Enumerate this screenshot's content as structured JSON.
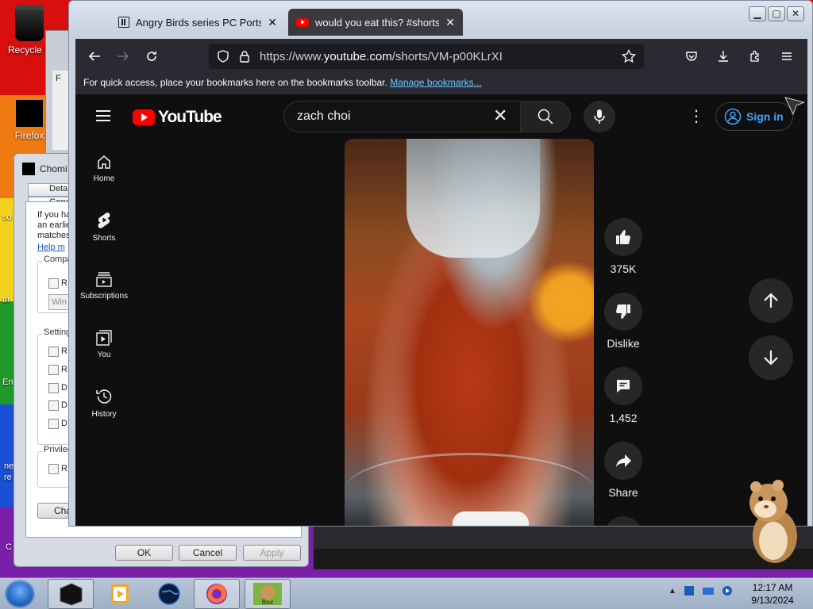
{
  "desktop": {
    "icons": [
      {
        "label": "Recycle B"
      },
      {
        "label": "Firefox"
      }
    ],
    "side_labels": [
      "so",
      "th",
      "En",
      "ne",
      "re",
      "C"
    ]
  },
  "bg_dialog": {
    "title": "Chomi",
    "tabs": [
      "Deta",
      "Genera"
    ],
    "intro_lines": [
      "If you ha",
      "an earlie",
      "matches"
    ],
    "help_link": "Help m",
    "group_compat": "Compa",
    "compat_checkbox": "R",
    "compat_dropdown": "Win",
    "group_settings": "Setting",
    "settings_items": [
      "R",
      "R",
      "D",
      "D",
      "D"
    ],
    "group_priv": "Privileg",
    "priv_item": "R",
    "change_button": "Cha",
    "ok": "OK",
    "cancel": "Cancel",
    "apply": "Apply"
  },
  "gray_window": {
    "label": "F"
  },
  "browser": {
    "tabs": [
      {
        "title": "Angry Birds series PC Ports : Ro"
      },
      {
        "title": "would you eat this? #shorts - Yo"
      }
    ],
    "url_prefix": "https://www.",
    "url_host": "youtube.com",
    "url_path": "/shorts/VM-p00KLrXI",
    "bookmarks_text": "For quick access, place your bookmarks here on the bookmarks toolbar.",
    "manage_bookmarks": "Manage bookmarks..."
  },
  "youtube": {
    "logo_text": "YouTube",
    "search_value": "zach choi",
    "sign_in": "Sign in",
    "guide": [
      {
        "label": "Home",
        "icon": "home-icon"
      },
      {
        "label": "Shorts",
        "icon": "shorts-icon"
      },
      {
        "label": "Subscriptions",
        "icon": "subscriptions-icon"
      },
      {
        "label": "You",
        "icon": "you-icon"
      },
      {
        "label": "History",
        "icon": "history-icon"
      }
    ],
    "actions": {
      "like_count": "375K",
      "dislike": "Dislike",
      "comments": "1,452",
      "share": "Share"
    }
  },
  "taskbar": {
    "time": "12:17 AM",
    "date": "9/13/2024"
  },
  "colors": {
    "yt_red": "#ff0000",
    "yt_bg": "#0f0f0f",
    "signin_blue": "#3ea6ff",
    "firefox_toolbar": "#2b2a33"
  }
}
